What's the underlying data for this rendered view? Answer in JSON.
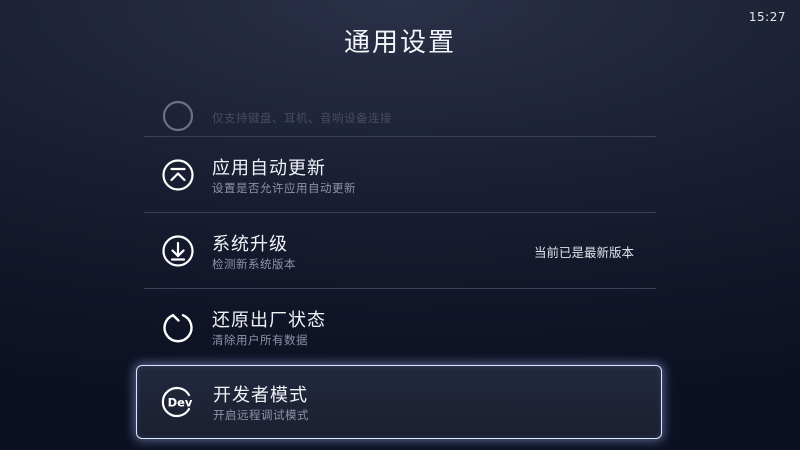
{
  "status_bar": {
    "time": "15:27"
  },
  "page": {
    "title": "通用设置"
  },
  "items": [
    {
      "icon": "bluetooth-device-icon",
      "label": "",
      "sub": "仅支持键盘、耳机、音响设备连接",
      "status": ""
    },
    {
      "icon": "app-update-icon",
      "label": "应用自动更新",
      "sub": "设置是否允许应用自动更新",
      "status": ""
    },
    {
      "icon": "system-upgrade-icon",
      "label": "系统升级",
      "sub": "检测新系统版本",
      "status": "当前已是最新版本"
    },
    {
      "icon": "factory-reset-icon",
      "label": "还原出厂状态",
      "sub": "清除用户所有数据",
      "status": ""
    },
    {
      "icon": "developer-mode-icon",
      "label": "开发者模式",
      "sub": "开启远程调试模式",
      "status": ""
    }
  ],
  "focused_item": "开发者模式",
  "colors": {
    "background": "#151a2d",
    "focus_border": "#dfe6ff",
    "subtitle": "#8d93a8"
  }
}
